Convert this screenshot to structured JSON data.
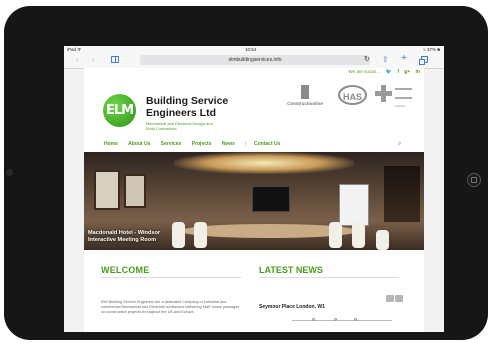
{
  "device": {
    "camera_icon": "camera-icon",
    "home_button_icon": "home-button-icon"
  },
  "status_bar": {
    "carrier": "iPad ᯤ",
    "time": "10:54",
    "battery": "≈ 37% ■"
  },
  "browser": {
    "back_icon": "chevron-left-icon",
    "forward_icon": "chevron-right-icon",
    "bookmarks_icon": "book-icon",
    "url": "elmbuildingservices.info",
    "reload_icon": "reload-icon",
    "share_icon": "share-icon",
    "new_tab_icon": "plus-icon",
    "tabs_icon": "tabs-icon"
  },
  "site": {
    "social": {
      "label": "We are social ...",
      "icons": [
        "twitter-icon",
        "facebook-icon",
        "google-plus-icon",
        "linkedin-icon"
      ],
      "glyphs": [
        "🐦",
        "f",
        "g+",
        "in"
      ]
    },
    "logo": {
      "text": "ELM",
      "name_line1": "Building Service",
      "name_line2": "Engineers Ltd",
      "tagline": "Mechanical and Electrical Design and Build Contractors"
    },
    "accreditations": {
      "constructionline": "Constructionline",
      "has": "HAS",
      "cross_caption": "member"
    },
    "nav": {
      "items": [
        "Home",
        "About Us",
        "Services",
        "Projects",
        "News",
        "Contact Us"
      ],
      "search_icon": "search-icon"
    },
    "hero": {
      "caption_line1": "Macdonald Hotel - Windsor",
      "caption_line2": "Interactive Meeting Room"
    },
    "welcome": {
      "title": "WELCOME",
      "body": "ElM Building Service Engineers are a dedicated Company of industrial and commercial Mechanical and Electrical contractors delivering M&E works packages on construction projects throughout the UK and Europe."
    },
    "news": {
      "title": "LATEST NEWS",
      "item": "Seymour Place London, W1",
      "prev_icon": "arrow-left-icon",
      "next_icon": "arrow-right-icon"
    }
  },
  "colors": {
    "brand_green": "#4a9c20",
    "ipad_bezel": "#161616",
    "browser_blue": "#3b7bdc"
  }
}
